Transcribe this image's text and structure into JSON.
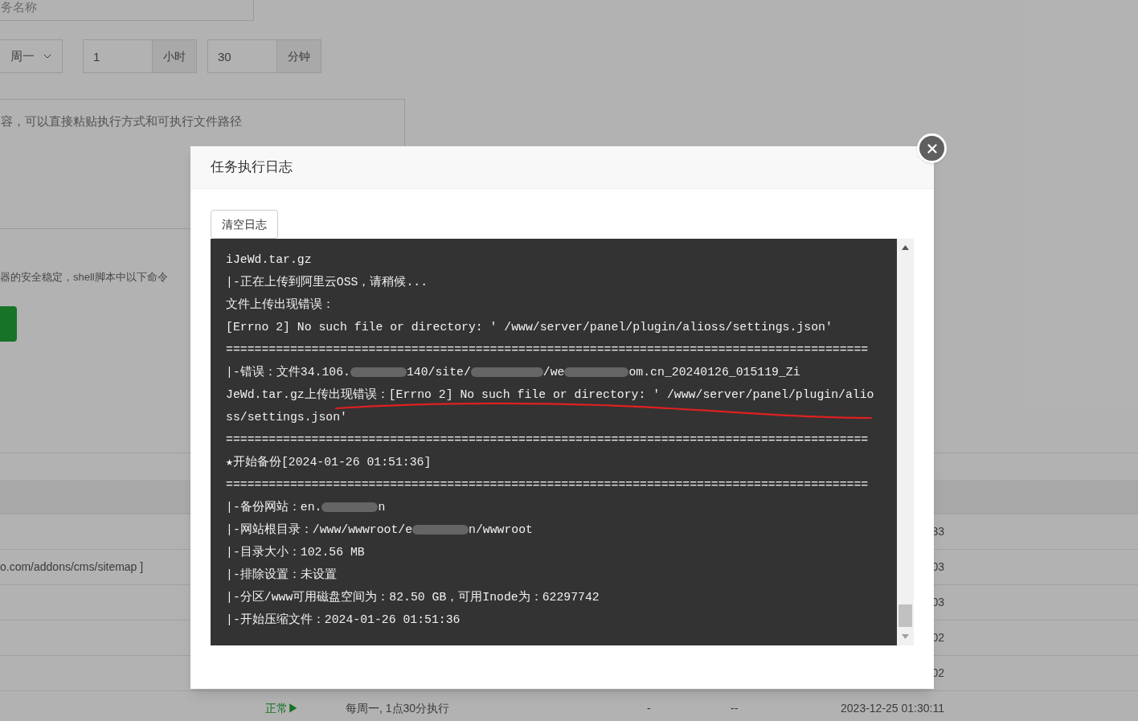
{
  "form": {
    "task_name": {
      "placeholder": "务名称"
    },
    "schedule": {
      "weekday": "周一",
      "hour": "1",
      "hour_unit": "小时",
      "minute": "30",
      "minute_unit": "分钟"
    },
    "script": {
      "placeholder": "容，可以直接粘贴执行方式和可执行文件路径"
    },
    "note": "器的安全稳定，shell脚本中以下命令"
  },
  "table": {
    "rows": [
      {
        "time": "33"
      },
      {
        "column_1": "o.com/addons/cms/sitemap ]",
        "time": "03"
      },
      {
        "time": "03"
      },
      {
        "time": "02"
      },
      {
        "time": "02"
      },
      {
        "status": "正常▶",
        "status_ok": true,
        "schedule": "每周一, 1点30分执行",
        "column_4": "-",
        "column_5": "--",
        "time": "2023-12-25 01:30:11"
      }
    ]
  },
  "dialog": {
    "title": "任务执行日志",
    "clear_button": "清空日志",
    "log_lines": [
      {
        "kind": "text",
        "text": "iJeWd.tar.gz"
      },
      {
        "kind": "text",
        "text": "|-正在上传到阿里云OSS，请稍候..."
      },
      {
        "kind": "text",
        "text": "文件上传出现错误："
      },
      {
        "kind": "text",
        "text": "[Errno 2] No such file or directory: ' /www/server/panel/plugin/alioss/settings.json'"
      },
      {
        "kind": "rule",
        "text": "=========================================================================================="
      },
      {
        "kind": "redacted",
        "segments": [
          "|-错误：文件34.106.",
          "140/site/",
          "/we",
          "om.cn_20240126_015119_Zi"
        ]
      },
      {
        "kind": "text",
        "text": "JeWd.tar.gz上传出现错误：[Errno 2] No such file or directory: ' /www/server/panel/plugin/alio"
      },
      {
        "kind": "text",
        "text": "ss/settings.json'"
      },
      {
        "kind": "rule",
        "text": "=========================================================================================="
      },
      {
        "kind": "text",
        "text": "★开始备份[2024-01-26 01:51:36]"
      },
      {
        "kind": "rule",
        "text": "=========================================================================================="
      },
      {
        "kind": "redacted",
        "segments": [
          "|-备份网站：en.",
          "n"
        ]
      },
      {
        "kind": "redacted",
        "segments": [
          "|-网站根目录：/www/wwwroot/e",
          "n/wwwroot"
        ]
      },
      {
        "kind": "text",
        "text": "|-目录大小：102.56 MB"
      },
      {
        "kind": "text",
        "text": "|-排除设置：未设置"
      },
      {
        "kind": "text",
        "text": "|-分区/www可用磁盘空间为：82.50 GB，可用Inode为：62297742"
      },
      {
        "kind": "text",
        "text": "|-开始压缩文件：2024-01-26 01:51:36"
      }
    ]
  }
}
